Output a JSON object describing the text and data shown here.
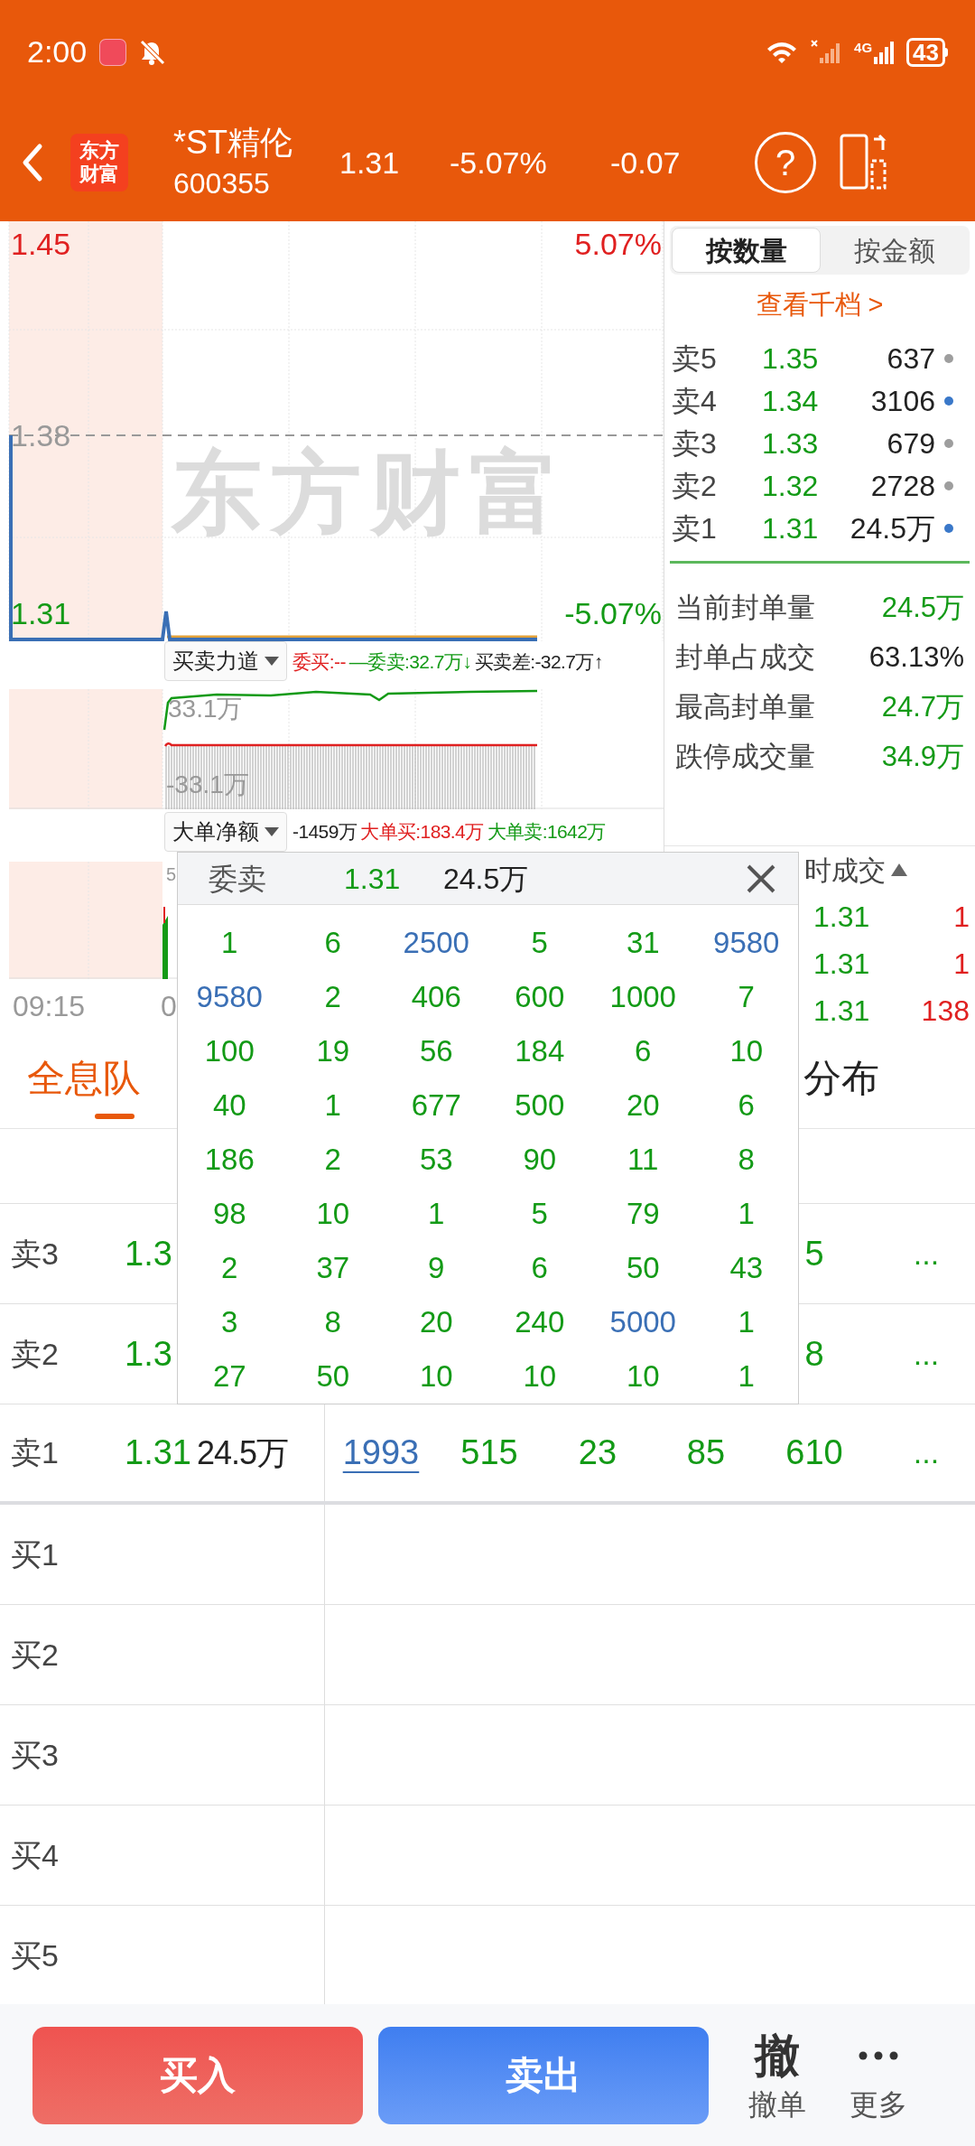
{
  "status_bar": {
    "time": "2:00",
    "network": "4G",
    "battery": "43"
  },
  "header": {
    "logo": [
      "东方",
      "财富"
    ],
    "name": "*ST精伦",
    "code": "600355",
    "price": "1.31",
    "change_pct": "-5.07%",
    "change": "-0.07",
    "help": "?"
  },
  "price_chart": {
    "watermark": "东方财富",
    "high": "1.45",
    "high_pct": "5.07%",
    "mid": "1.38",
    "low": "1.31",
    "low_pct": "-5.07%"
  },
  "indicator_1": {
    "selector": "买卖力道",
    "items": [
      {
        "text": "委买:--",
        "color": "#e02020"
      },
      {
        "text": "—委卖:32.7万↓",
        "color": "#139a16"
      },
      {
        "text": "买卖差:-32.7万↑",
        "color": "#222222"
      }
    ]
  },
  "sub_chart": {
    "top_label": "33.1万",
    "bottom_label": "-33.1万"
  },
  "indicator_2": {
    "selector": "大单净额",
    "items": [
      {
        "text": "-1459万",
        "color": "#222222"
      },
      {
        "text": "大单买:183.4万",
        "color": "#e02020"
      },
      {
        "text": "大单卖:1642万",
        "color": "#139a16"
      }
    ]
  },
  "flow_chart": {
    "label": "5"
  },
  "time_axis": [
    "09:15",
    "0"
  ],
  "depth_panel": {
    "tabs": [
      {
        "label": "按数量",
        "selected": true
      },
      {
        "label": "按金额",
        "selected": false
      }
    ],
    "link": "查看千档 >",
    "asks": [
      {
        "label": "卖5",
        "price": "1.35",
        "volume": "637",
        "color": "#9e9e9e"
      },
      {
        "label": "卖4",
        "price": "1.34",
        "volume": "3106",
        "color": "#3a78c9"
      },
      {
        "label": "卖3",
        "price": "1.33",
        "volume": "679",
        "color": "#9e9e9e"
      },
      {
        "label": "卖2",
        "price": "1.32",
        "volume": "2728",
        "color": "#9e9e9e"
      },
      {
        "label": "卖1",
        "price": "1.31",
        "volume": "24.5万",
        "color": "#3a78c9"
      }
    ],
    "stats": [
      {
        "label": "当前封单量",
        "value": "24.5万",
        "color": "#139a16"
      },
      {
        "label": "封单占成交",
        "value": "63.13%",
        "color": "#222222"
      },
      {
        "label": "最高封单量",
        "value": "24.7万",
        "color": "#139a16"
      },
      {
        "label": "跌停成交量",
        "value": "34.9万",
        "color": "#139a16"
      }
    ]
  },
  "trades": {
    "title": "时成交",
    "rows": [
      {
        "price": "1.31",
        "volume": "1"
      },
      {
        "price": "1.31",
        "volume": "1"
      },
      {
        "price": "1.31",
        "volume": "138"
      }
    ]
  },
  "queue_tabs": [
    {
      "label": "全息队",
      "selected": true
    },
    {
      "label": "分布",
      "selected": false
    }
  ],
  "queue_table": {
    "ask_rows": [
      {
        "label": "卖3",
        "price": "1.3",
        "queue": [
          {
            "text": "5",
            "selected": false
          }
        ],
        "more": "..."
      },
      {
        "label": "卖2",
        "price": "1.3",
        "queue": [
          {
            "text": "8",
            "selected": false
          }
        ],
        "more": "..."
      },
      {
        "label": "卖1",
        "price": "1.31",
        "volume": "24.5万",
        "queue": [
          {
            "text": "1993",
            "selected": true
          },
          {
            "text": "515",
            "selected": false
          },
          {
            "text": "23",
            "selected": false
          },
          {
            "text": "85",
            "selected": false
          },
          {
            "text": "610",
            "selected": false
          }
        ],
        "more": "..."
      }
    ],
    "bid_rows": [
      {
        "label": "买1"
      },
      {
        "label": "买2"
      },
      {
        "label": "买3"
      },
      {
        "label": "买4"
      },
      {
        "label": "买5"
      }
    ]
  },
  "popup": {
    "title": "委卖",
    "price": "1.31",
    "volume": "24.5万",
    "rows": [
      [
        {
          "text": "1",
          "large": false
        },
        {
          "text": "6",
          "large": false
        },
        {
          "text": "2500",
          "large": true
        },
        {
          "text": "5",
          "large": false
        },
        {
          "text": "31",
          "large": false
        },
        {
          "text": "9580",
          "large": true
        }
      ],
      [
        {
          "text": "9580",
          "large": true
        },
        {
          "text": "2",
          "large": false
        },
        {
          "text": "406",
          "large": false
        },
        {
          "text": "600",
          "large": false
        },
        {
          "text": "1000",
          "large": false
        },
        {
          "text": "7",
          "large": false
        }
      ],
      [
        {
          "text": "100",
          "large": false
        },
        {
          "text": "19",
          "large": false
        },
        {
          "text": "56",
          "large": false
        },
        {
          "text": "184",
          "large": false
        },
        {
          "text": "6",
          "large": false
        },
        {
          "text": "10",
          "large": false
        }
      ],
      [
        {
          "text": "40",
          "large": false
        },
        {
          "text": "1",
          "large": false
        },
        {
          "text": "677",
          "large": false
        },
        {
          "text": "500",
          "large": false
        },
        {
          "text": "20",
          "large": false
        },
        {
          "text": "6",
          "large": false
        }
      ],
      [
        {
          "text": "186",
          "large": false
        },
        {
          "text": "2",
          "large": false
        },
        {
          "text": "53",
          "large": false
        },
        {
          "text": "90",
          "large": false
        },
        {
          "text": "11",
          "large": false
        },
        {
          "text": "8",
          "large": false
        }
      ],
      [
        {
          "text": "98",
          "large": false
        },
        {
          "text": "10",
          "large": false
        },
        {
          "text": "1",
          "large": false
        },
        {
          "text": "5",
          "large": false
        },
        {
          "text": "79",
          "large": false
        },
        {
          "text": "1",
          "large": false
        }
      ],
      [
        {
          "text": "2",
          "large": false
        },
        {
          "text": "37",
          "large": false
        },
        {
          "text": "9",
          "large": false
        },
        {
          "text": "6",
          "large": false
        },
        {
          "text": "50",
          "large": false
        },
        {
          "text": "43",
          "large": false
        }
      ],
      [
        {
          "text": "3",
          "large": false
        },
        {
          "text": "8",
          "large": false
        },
        {
          "text": "20",
          "large": false
        },
        {
          "text": "240",
          "large": false
        },
        {
          "text": "5000",
          "large": true
        },
        {
          "text": "1",
          "large": false
        }
      ],
      [
        {
          "text": "27",
          "large": false
        },
        {
          "text": "50",
          "large": false
        },
        {
          "text": "10",
          "large": false
        },
        {
          "text": "10",
          "large": false
        },
        {
          "text": "10",
          "large": false
        },
        {
          "text": "1",
          "large": false
        }
      ]
    ]
  },
  "actions": {
    "buy": "买入",
    "sell": "卖出",
    "cancel_icon": "撤",
    "cancel": "撤单",
    "more": "更多"
  }
}
